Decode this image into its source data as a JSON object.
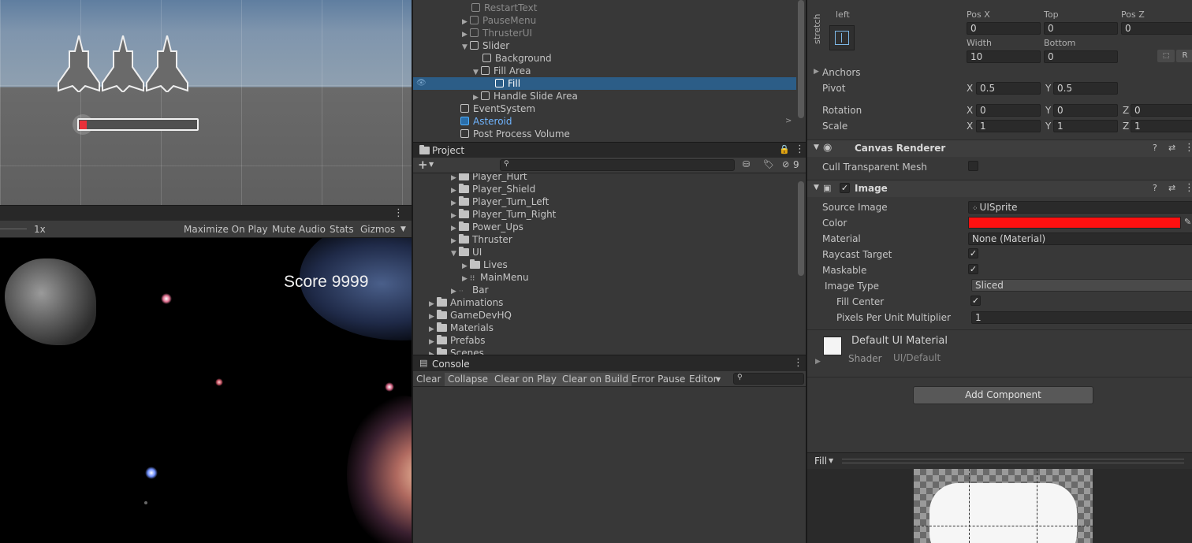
{
  "scene": {},
  "game": {
    "toolbar": {
      "scale": "1x",
      "maximize": "Maximize On Play",
      "mute": "Mute Audio",
      "stats": "Stats",
      "gizmos": "Gizmos"
    },
    "score_text": "Score 9999"
  },
  "hierarchy": {
    "items": [
      {
        "label": "RestartText",
        "dim": true
      },
      {
        "label": "PauseMenu",
        "dim": true
      },
      {
        "label": "ThrusterUI",
        "dim": true
      },
      {
        "label": "Slider"
      },
      {
        "label": "Background"
      },
      {
        "label": "Fill Area"
      },
      {
        "label": "Fill"
      },
      {
        "label": "Handle Slide Area"
      },
      {
        "label": "EventSystem"
      },
      {
        "label": "Asteroid"
      },
      {
        "label": "Post Process Volume"
      }
    ]
  },
  "project": {
    "title": "Project",
    "hidden_count": "9",
    "items": [
      "Player_Hurt",
      "Player_Shield",
      "Player_Turn_Left",
      "Player_Turn_Right",
      "Power_Ups",
      "Thruster",
      "UI",
      "Lives",
      "MainMenu",
      "Bar",
      "Animations",
      "GameDevHQ",
      "Materials",
      "Prefabs",
      "Scenes"
    ]
  },
  "console": {
    "title": "Console",
    "buttons": [
      "Clear",
      "Collapse",
      "Clear on Play",
      "Clear on Build",
      "Error Pause",
      "Editor"
    ]
  },
  "inspector": {
    "rect": {
      "anchor_h": "left",
      "anchor_v": "stretch",
      "pos_x_label": "Pos X",
      "pos_x": "0",
      "top_label": "Top",
      "top": "0",
      "pos_z_label": "Pos Z",
      "pos_z": "0",
      "width_label": "Width",
      "width": "10",
      "bottom_label": "Bottom",
      "bottom": "0",
      "r_label": "R",
      "anchors": "Anchors",
      "pivot": "Pivot",
      "pivot_x": "0.5",
      "pivot_y": "0.5",
      "rotation": "Rotation",
      "rot_x": "0",
      "rot_y": "0",
      "rot_z": "0",
      "scale": "Scale",
      "scale_x": "1",
      "scale_y": "1",
      "scale_z": "1",
      "axis_x": "X",
      "axis_y": "Y",
      "axis_z": "Z"
    },
    "canvas_renderer": {
      "title": "Canvas Renderer",
      "cull": "Cull Transparent Mesh"
    },
    "image": {
      "title": "Image",
      "source_image_label": "Source Image",
      "source_image": "UISprite",
      "color_label": "Color",
      "color": "#ff1010",
      "material_label": "Material",
      "material": "None (Material)",
      "raycast_label": "Raycast Target",
      "maskable_label": "Maskable",
      "image_type_label": "Image Type",
      "image_type": "Sliced",
      "fill_center_label": "Fill Center",
      "ppu_label": "Pixels Per Unit Multiplier",
      "ppu": "1"
    },
    "material": {
      "name": "Default UI Material",
      "shader_label": "Shader",
      "shader": "UI/Default"
    },
    "add_component": "Add Component",
    "preview_label": "Fill"
  }
}
